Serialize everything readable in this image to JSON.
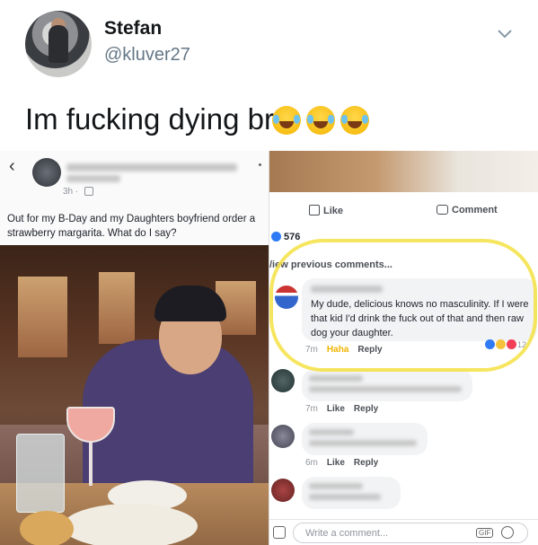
{
  "tweet": {
    "display_name": "Stefan",
    "handle": "@kluver27",
    "text": "Im fucking dying bro",
    "emoji": [
      "😂",
      "😂",
      "😂"
    ]
  },
  "left_post": {
    "time": "3h ·",
    "text": "Out for my B-Day and my Daughters boyfriend order a strawberry margarita. What do I say?"
  },
  "right_post": {
    "like_label": "Like",
    "comment_label": "Comment",
    "reaction_count": "576",
    "view_previous": "/iew previous comments...",
    "comments": [
      {
        "text": "My dude, delicious knows no masculinity. If I were that kid I'd drink the fuck out of that and then raw dog your daughter.",
        "time": "7m",
        "reaction": "Haha",
        "reply": "Reply",
        "reaction_count": "12"
      },
      {
        "time": "7m",
        "like": "Like",
        "reply": "Reply"
      },
      {
        "time": "6m",
        "like": "Like",
        "reply": "Reply"
      }
    ],
    "write_placeholder": "Write a comment...",
    "gif_label": "GIF"
  },
  "colors": {
    "fb_blue": "#2f7bf6",
    "highlight": "#f5e042",
    "haha": "#f0b400"
  }
}
